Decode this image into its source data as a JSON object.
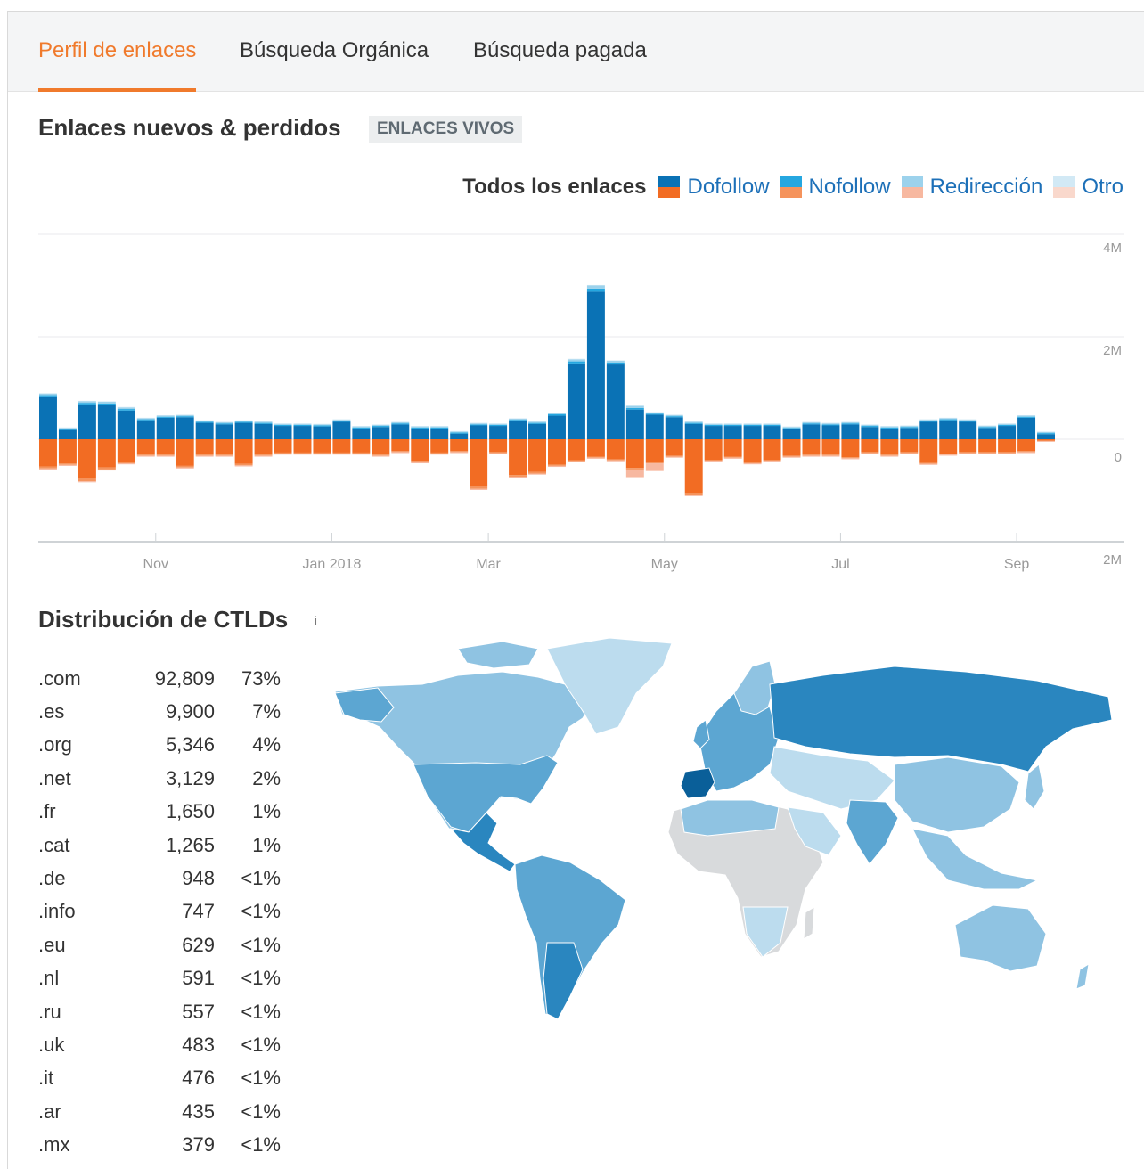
{
  "tabs": [
    {
      "label": "Perfil de enlaces",
      "active": true
    },
    {
      "label": "Búsqueda Orgánica",
      "active": false
    },
    {
      "label": "Búsqueda pagada",
      "active": false
    }
  ],
  "links_section": {
    "title": "Enlaces nuevos & perdidos",
    "badge": "ENLACES VIVOS"
  },
  "legend": {
    "all_label": "Todos los enlaces",
    "items": [
      {
        "label": "Dofollow",
        "new_color": "#0a72b5",
        "lost_color": "#f26c23"
      },
      {
        "label": "Nofollow",
        "new_color": "#25a7e0",
        "lost_color": "#f5935c"
      },
      {
        "label": "Redirección",
        "new_color": "#9cd2ec",
        "lost_color": "#f7b8a0"
      },
      {
        "label": "Otro",
        "new_color": "#d2e9f5",
        "lost_color": "#f9d8cc"
      }
    ]
  },
  "chart_data": {
    "type": "bar",
    "title": "Enlaces nuevos & perdidos",
    "y_ticks": [
      "4M",
      "2M",
      "0",
      "2M"
    ],
    "ylim": [
      -2000000,
      4000000
    ],
    "x_tick_labels": [
      {
        "label": "Nov",
        "index": 5.5
      },
      {
        "label": "Jan 2018",
        "index": 14.5
      },
      {
        "label": "Mar",
        "index": 22.5
      },
      {
        "label": "May",
        "index": 31.5
      },
      {
        "label": "Jul",
        "index": 40.5
      },
      {
        "label": "Sep",
        "index": 49.5
      }
    ],
    "series": [
      {
        "name": "Dofollow",
        "values": [
          820000,
          180000,
          680000,
          670000,
          560000,
          370000,
          420000,
          430000,
          320000,
          290000,
          320000,
          300000,
          260000,
          260000,
          250000,
          340000,
          210000,
          240000,
          290000,
          210000,
          210000,
          110000,
          270000,
          260000,
          360000,
          300000,
          460000,
          1480000,
          2880000,
          1460000,
          580000,
          480000,
          430000,
          300000,
          260000,
          260000,
          260000,
          260000,
          200000,
          290000,
          270000,
          290000,
          240000,
          210000,
          220000,
          340000,
          370000,
          340000,
          220000,
          260000,
          420000,
          100000
        ]
      },
      {
        "name": "Nofollow",
        "values": [
          40000,
          20000,
          30000,
          30000,
          30000,
          20000,
          20000,
          20000,
          20000,
          20000,
          20000,
          20000,
          20000,
          20000,
          20000,
          20000,
          20000,
          20000,
          20000,
          20000,
          20000,
          20000,
          20000,
          20000,
          20000,
          20000,
          30000,
          40000,
          60000,
          40000,
          30000,
          20000,
          20000,
          20000,
          20000,
          20000,
          20000,
          20000,
          20000,
          20000,
          20000,
          20000,
          20000,
          20000,
          20000,
          20000,
          20000,
          20000,
          20000,
          20000,
          20000,
          20000
        ]
      },
      {
        "name": "Redirección",
        "values": [
          30000,
          20000,
          30000,
          30000,
          30000,
          20000,
          20000,
          20000,
          20000,
          20000,
          20000,
          20000,
          20000,
          20000,
          20000,
          20000,
          20000,
          20000,
          20000,
          20000,
          20000,
          20000,
          20000,
          20000,
          20000,
          20000,
          20000,
          40000,
          60000,
          30000,
          40000,
          20000,
          20000,
          20000,
          20000,
          20000,
          20000,
          20000,
          20000,
          20000,
          20000,
          20000,
          20000,
          20000,
          20000,
          20000,
          20000,
          20000,
          20000,
          20000,
          20000,
          20000
        ]
      },
      {
        "name": "Otro",
        "values": [
          10000,
          10000,
          10000,
          10000,
          10000,
          10000,
          10000,
          10000,
          10000,
          10000,
          10000,
          10000,
          10000,
          10000,
          10000,
          10000,
          10000,
          10000,
          10000,
          10000,
          10000,
          10000,
          10000,
          10000,
          10000,
          10000,
          10000,
          10000,
          10000,
          10000,
          10000,
          10000,
          10000,
          10000,
          10000,
          10000,
          10000,
          10000,
          10000,
          10000,
          10000,
          10000,
          10000,
          10000,
          10000,
          10000,
          10000,
          10000,
          10000,
          10000,
          10000,
          10000
        ]
      }
    ],
    "lost_series": [
      {
        "name": "Dofollow",
        "values": [
          -530000,
          -470000,
          -760000,
          -550000,
          -440000,
          -300000,
          -300000,
          -520000,
          -300000,
          -300000,
          -480000,
          -300000,
          -260000,
          -260000,
          -260000,
          -260000,
          -260000,
          -300000,
          -230000,
          -420000,
          -260000,
          -230000,
          -920000,
          -250000,
          -700000,
          -640000,
          -500000,
          -410000,
          -340000,
          -390000,
          -560000,
          -450000,
          -320000,
          -1050000,
          -400000,
          -340000,
          -450000,
          -400000,
          -320000,
          -300000,
          -300000,
          -350000,
          -250000,
          -300000,
          -250000,
          -460000,
          -280000,
          -250000,
          -250000,
          -250000,
          -230000,
          -30000
        ]
      },
      {
        "name": "Nofollow",
        "values": [
          -40000,
          -30000,
          -60000,
          -40000,
          -30000,
          -20000,
          -20000,
          -30000,
          -20000,
          -20000,
          -30000,
          -20000,
          -20000,
          -20000,
          -20000,
          -20000,
          -20000,
          -20000,
          -20000,
          -30000,
          -20000,
          -20000,
          -50000,
          -20000,
          -30000,
          -30000,
          -20000,
          -20000,
          -20000,
          -20000,
          -30000,
          -20000,
          -20000,
          -40000,
          -20000,
          -20000,
          -20000,
          -20000,
          -20000,
          -20000,
          -20000,
          -20000,
          -20000,
          -20000,
          -20000,
          -20000,
          -20000,
          -20000,
          -20000,
          -20000,
          -20000,
          -10000
        ]
      },
      {
        "name": "Redirección",
        "values": [
          -20000,
          -20000,
          -20000,
          -20000,
          -20000,
          -20000,
          -20000,
          -20000,
          -20000,
          -20000,
          -20000,
          -20000,
          -20000,
          -20000,
          -20000,
          -20000,
          -20000,
          -20000,
          -20000,
          -20000,
          -20000,
          -20000,
          -20000,
          -20000,
          -20000,
          -20000,
          -20000,
          -20000,
          -20000,
          -20000,
          -150000,
          -150000,
          -20000,
          -20000,
          -20000,
          -20000,
          -20000,
          -20000,
          -20000,
          -20000,
          -20000,
          -20000,
          -20000,
          -20000,
          -20000,
          -20000,
          -20000,
          -20000,
          -20000,
          -20000,
          -20000,
          -10000
        ]
      }
    ]
  },
  "ctld_section": {
    "title": "Distribución de CTLDs",
    "info_icon": "info-icon",
    "rows": [
      {
        "domain": ".com",
        "count": "92,809",
        "pct": "73%"
      },
      {
        "domain": ".es",
        "count": "9,900",
        "pct": "7%"
      },
      {
        "domain": ".org",
        "count": "5,346",
        "pct": "4%"
      },
      {
        "domain": ".net",
        "count": "3,129",
        "pct": "2%"
      },
      {
        "domain": ".fr",
        "count": "1,650",
        "pct": "1%"
      },
      {
        "domain": ".cat",
        "count": "1,265",
        "pct": "1%"
      },
      {
        "domain": ".de",
        "count": "948",
        "pct": "<1%"
      },
      {
        "domain": ".info",
        "count": "747",
        "pct": "<1%"
      },
      {
        "domain": ".eu",
        "count": "629",
        "pct": "<1%"
      },
      {
        "domain": ".nl",
        "count": "591",
        "pct": "<1%"
      },
      {
        "domain": ".ru",
        "count": "557",
        "pct": "<1%"
      },
      {
        "domain": ".uk",
        "count": "483",
        "pct": "<1%"
      },
      {
        "domain": ".it",
        "count": "476",
        "pct": "<1%"
      },
      {
        "domain": ".ar",
        "count": "435",
        "pct": "<1%"
      },
      {
        "domain": ".mx",
        "count": "379",
        "pct": "<1%"
      }
    ]
  },
  "map": {
    "colors": {
      "dark": "#2a86bf",
      "medium": "#5ca6d2",
      "light": "#8fc3e2",
      "pale": "#bcdcee",
      "none": "#d8dadc"
    }
  }
}
